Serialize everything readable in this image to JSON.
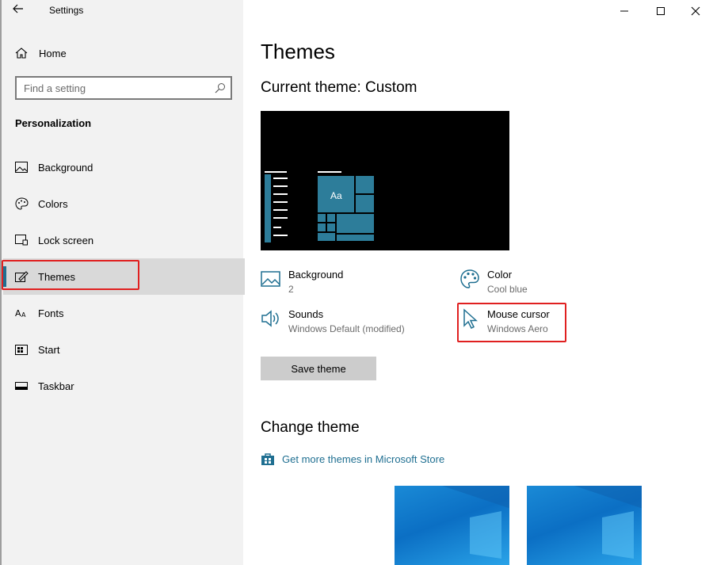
{
  "window": {
    "title": "Settings",
    "controls": {
      "minimize": "minimize-icon",
      "maximize": "maximize-icon",
      "close": "close-icon"
    }
  },
  "sidebar": {
    "home_label": "Home",
    "search_placeholder": "Find a setting",
    "section_title": "Personalization",
    "items": [
      {
        "label": "Background",
        "icon": "image-icon"
      },
      {
        "label": "Colors",
        "icon": "palette-icon"
      },
      {
        "label": "Lock screen",
        "icon": "lock-screen-icon"
      },
      {
        "label": "Themes",
        "icon": "themes-icon",
        "active": true
      },
      {
        "label": "Fonts",
        "icon": "fonts-icon"
      },
      {
        "label": "Start",
        "icon": "start-icon"
      },
      {
        "label": "Taskbar",
        "icon": "taskbar-icon"
      }
    ]
  },
  "main": {
    "title": "Themes",
    "current_theme": "Current theme: Custom",
    "props": {
      "background": {
        "label": "Background",
        "value": "2"
      },
      "color": {
        "label": "Color",
        "value": "Cool blue"
      },
      "sounds": {
        "label": "Sounds",
        "value": "Windows Default (modified)"
      },
      "mouse": {
        "label": "Mouse cursor",
        "value": "Windows Aero"
      }
    },
    "save_label": "Save theme",
    "change_theme_title": "Change theme",
    "store_link": "Get more themes in Microsoft Store"
  },
  "colors": {
    "accent": "#2d7d9a",
    "link": "#1f6f91",
    "highlight_box": "#e02020"
  }
}
